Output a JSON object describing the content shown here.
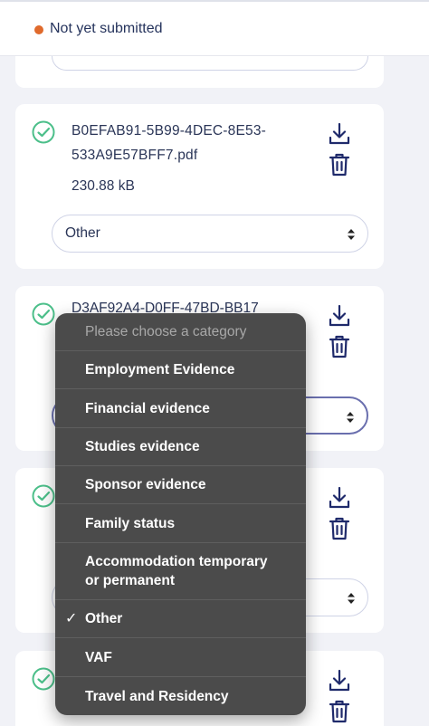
{
  "status": {
    "text": "Not yet submitted",
    "color": "#e06a2c"
  },
  "files": [
    {
      "name_line1": "B0EFAB91-5B99-4DEC-8E53-",
      "name_line2": "533A9E57BFF7.pdf",
      "size": "230.88 kB",
      "category": "Other"
    },
    {
      "name_line1": "D3AF92A4-D0FF-47BD-BB17",
      "category": ""
    }
  ],
  "dropdown": {
    "placeholder": "Please choose a category",
    "options": [
      "Employment Evidence",
      "Financial evidence",
      "Studies evidence",
      "Sponsor evidence",
      "Family status",
      "Accommodation temporary or permanent",
      "Other",
      "VAF",
      "Travel and Residency"
    ],
    "selected_mark": "✓"
  },
  "icons": {
    "check": "check-circle-icon",
    "download": "download-icon",
    "trash": "trash-icon",
    "select_arrow": "select-updown-icon"
  },
  "colors": {
    "accent": "#1f2a6b",
    "success": "#4cbf8a",
    "dropdown_bg": "#4b4b4b"
  }
}
